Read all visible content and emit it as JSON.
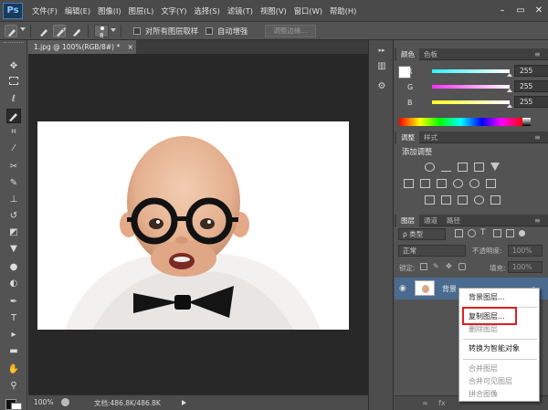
{
  "app": {
    "logo": "Ps"
  },
  "menu": [
    "文件(F)",
    "编辑(E)",
    "图像(I)",
    "图层(L)",
    "文字(Y)",
    "选择(S)",
    "滤镜(T)",
    "视图(V)",
    "窗口(W)",
    "帮助(H)"
  ],
  "window_controls": {
    "minimize": "–",
    "restore": "▭",
    "close": "✕"
  },
  "options_bar": {
    "brush_size": "8",
    "sample_all_layers": "对所有图层取样",
    "auto_enhance": "自动增强",
    "refine_edge": "调整边缘..."
  },
  "document": {
    "tab_label": "1.jpg @ 100%(RGB/8#) *",
    "tab_close": "×",
    "zoom": "100%",
    "doc_info": "文档:486.8K/486.8K"
  },
  "tools": [
    "move-tool-icon",
    "marquee-tool-icon",
    "lasso-tool-icon",
    "quick-selection-tool-icon",
    "crop-tool-icon",
    "eyedropper-tool-icon",
    "healing-brush-icon",
    "brush-tool-icon",
    "clone-stamp-icon",
    "history-brush-icon",
    "eraser-icon",
    "paint-bucket-icon",
    "blur-tool-icon",
    "dodge-tool-icon",
    "pen-tool-icon",
    "type-tool-icon",
    "path-selection-icon",
    "rectangle-tool-icon",
    "hand-tool-icon",
    "zoom-tool-icon"
  ],
  "color_panel": {
    "tabs": [
      "颜色",
      "色板"
    ],
    "channels": [
      {
        "label": "R",
        "value": "255",
        "color": "#ff2020"
      },
      {
        "label": "G",
        "value": "255",
        "color": "#20ff20"
      },
      {
        "label": "B",
        "value": "255",
        "color": "#3040ff"
      }
    ]
  },
  "adjustments_panel": {
    "tabs": [
      "调整",
      "样式"
    ],
    "title": "添加调整"
  },
  "layers_panel": {
    "tabs": [
      "图层",
      "通道",
      "路径"
    ],
    "filter_label": "ρ 类型",
    "blend_mode": "正常",
    "opacity_label": "不透明度:",
    "opacity_value": "100%",
    "lock_label": "锁定:",
    "fill_label": "填充:",
    "fill_value": "100%",
    "layer_name": "背景"
  },
  "context_menu": {
    "items": [
      {
        "label": "背景图层...",
        "enabled": true
      },
      {
        "label": "复制图层...",
        "enabled": true,
        "highlighted": true
      },
      {
        "label": "删除图层",
        "enabled": false
      },
      {
        "label": "转换为智能对象",
        "enabled": true
      },
      {
        "label": "合并图层",
        "enabled": false
      },
      {
        "label": "合并可见图层",
        "enabled": false
      },
      {
        "label": "拼合图像",
        "enabled": false
      }
    ]
  },
  "colors": {
    "highlight_border": "#e02020",
    "canvas_bg": "#282828",
    "ui_bg": "#535353"
  }
}
